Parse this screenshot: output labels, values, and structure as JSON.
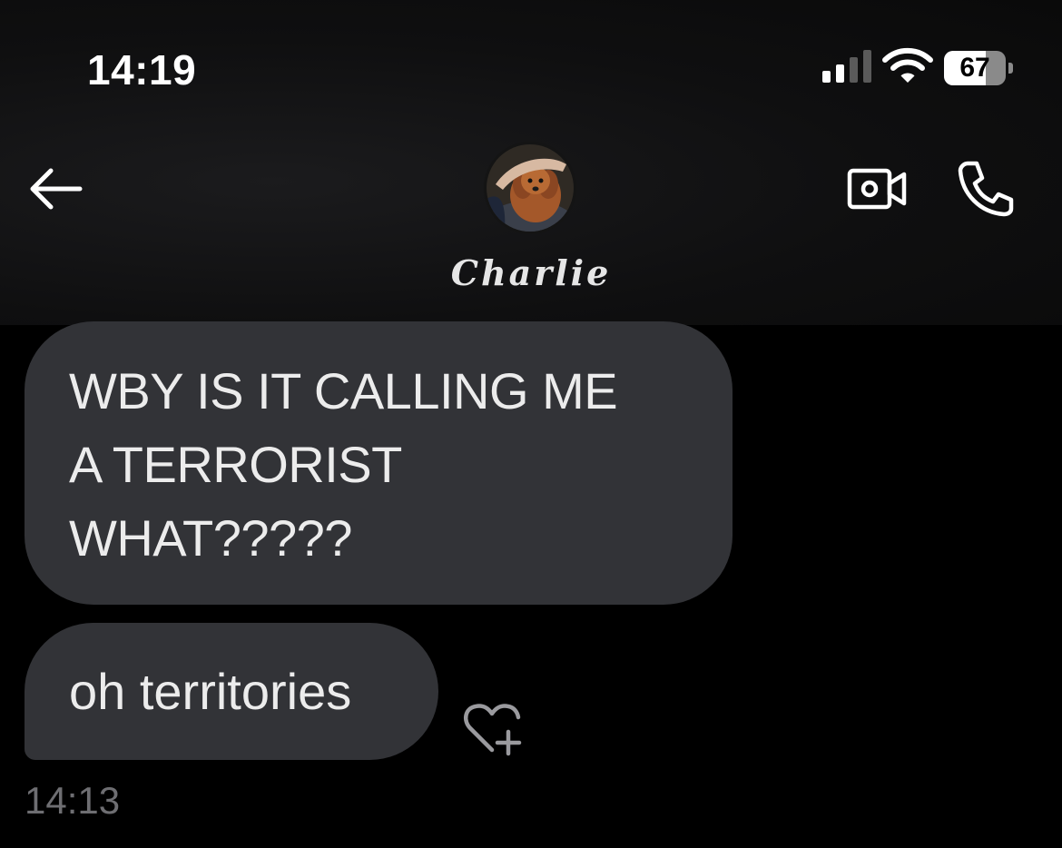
{
  "status_bar": {
    "time": "14:19",
    "signal_icon": "cellular-signal-icon",
    "wifi_icon": "wifi-icon",
    "battery_percent": 67,
    "battery_label": "67"
  },
  "header": {
    "back_icon": "arrow-left-icon",
    "contact_name": "Charlie",
    "avatar_icon": "contact-avatar",
    "video_icon": "video-camera-icon",
    "call_icon": "phone-icon"
  },
  "messages": [
    {
      "lines": [
        "WBY IS IT CALLING ME",
        "A TERRORIST",
        "WHAT?????"
      ]
    },
    {
      "text": "oh territories"
    }
  ],
  "react_icon": "heart-plus-icon",
  "timestamp": "14:13",
  "colors": {
    "background": "#000000",
    "bubble": "#323337",
    "bubble_text": "#ececec",
    "timestamp": "#6e6e72"
  }
}
